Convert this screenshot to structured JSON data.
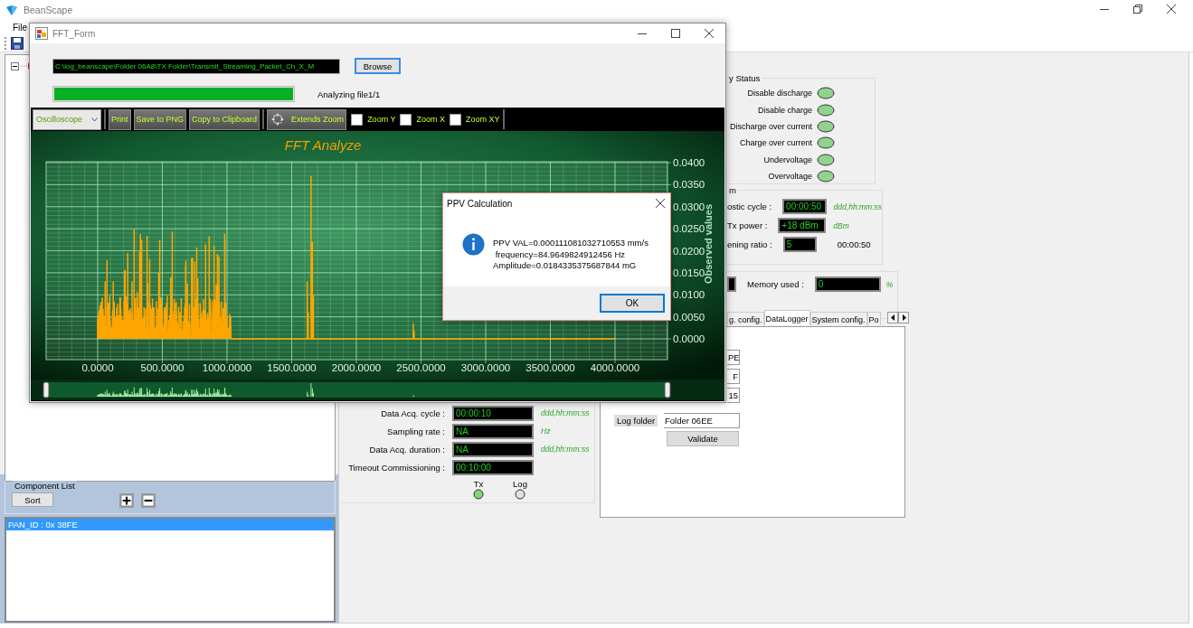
{
  "main_window": {
    "title": "BeanScape",
    "menu": [
      "File"
    ]
  },
  "tree": {
    "expanded": true
  },
  "component_list": {
    "title": "Component List",
    "sort_button": "Sort",
    "items": [
      {
        "label": "PAN_ID : 0x 38FE",
        "selected": true
      }
    ]
  },
  "battery_status": {
    "title": "y Status",
    "indicators": [
      {
        "label": "Disable discharge",
        "on": true
      },
      {
        "label": "Disable charge",
        "on": true
      },
      {
        "label": "Discharge over current",
        "on": true
      },
      {
        "label": "Charge over current",
        "on": true
      },
      {
        "label": "Undervoltage",
        "on": true
      },
      {
        "label": "Overvoltage",
        "on": true
      }
    ]
  },
  "radio_settings": {
    "title": "m",
    "rows": [
      {
        "label": "ostic cycle :",
        "value": "00:00:50",
        "unit": "ddd,hh:mm:ss"
      },
      {
        "label": "Tx power :",
        "value": "+18 dBm",
        "unit": "dBm"
      },
      {
        "label": "ening ratio :",
        "value": "5",
        "note": "00:00:50"
      }
    ]
  },
  "memory": {
    "label": "Memory used :",
    "value": "0",
    "unit": "%"
  },
  "config_tabs": [
    {
      "label": "g. config.",
      "selected": false
    },
    {
      "label": "DataLogger",
      "selected": true
    },
    {
      "label": "System config.",
      "selected": false
    },
    {
      "label": "Po",
      "selected": false
    }
  ],
  "datalogger": {
    "fields": [
      "PE",
      "F",
      "15"
    ],
    "log_folder_label": "Log folder",
    "log_folder": "Folder 06EE",
    "validate_button": "Validate"
  },
  "acquisition": {
    "rows": [
      {
        "label": "Data Acq. cycle :",
        "value": "00:00:10",
        "unit": "ddd,hh:mm:ss"
      },
      {
        "label": "Sampling rate :",
        "value": "NA",
        "unit": "Hz"
      },
      {
        "label": "Data Acq. duration :",
        "value": "NA",
        "unit": "ddd,hh:mm:ss"
      },
      {
        "label": "Timeout Commissioning :",
        "value": "00:10:00"
      }
    ],
    "leds": [
      {
        "label": "Tx",
        "on": true
      },
      {
        "label": "Log",
        "on": false
      }
    ]
  },
  "fft_window": {
    "title": "FFT_Form",
    "file_path": "C:\\log_beanscape\\Folder 06A8\\TX Folder\\Transmit_Streaming_Packet_Ch_X_M",
    "browse_button": "Browse",
    "progress": {
      "level": 1
    },
    "status": "Analyzing file1/1",
    "toolbar": {
      "mode": "Oscilloscope",
      "buttons": [
        {
          "label": "Print"
        },
        {
          "label": "Save to PNG"
        },
        {
          "label": "Copy to Clipboard"
        },
        {
          "label": "Extends Zoom",
          "has_icon": true
        }
      ],
      "zoom_options": [
        {
          "label": "Zoom Y",
          "checked": false
        },
        {
          "label": "Zoom X",
          "checked": false
        },
        {
          "label": "Zoom XY",
          "checked": false
        }
      ]
    },
    "chart": {
      "title": "FFT Analyze",
      "y_label": "Observed values",
      "x_ticks": [
        "0.0000",
        "500.0000",
        "1000.0000",
        "1500.0000",
        "2000.0000",
        "2500.0000",
        "3000.0000",
        "3500.0000",
        "4000.0000"
      ],
      "y_ticks": [
        "0.0400",
        "0.0350",
        "0.0300",
        "0.0250",
        "0.0200",
        "0.0150",
        "0.0100",
        "0.0050",
        "0.0000"
      ]
    }
  },
  "dialog": {
    "title": "PPV Calculation",
    "lines": [
      "PPV VAL=0.000111081032710553 mm/s",
      " frequency=84.9649824912456 Hz",
      "Amplitude=0.0184335375687844 mG"
    ],
    "ok_button": "OK"
  }
}
